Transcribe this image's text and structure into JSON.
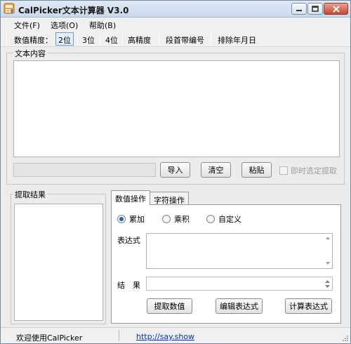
{
  "window": {
    "title": "CalPicker文本计算器 V3.0",
    "icon": "calculator-app-icon",
    "controls": [
      "minimize-icon",
      "maximize-icon",
      "close-icon"
    ]
  },
  "menu": {
    "file": "文件(F)",
    "options": "选项(O)",
    "help": "帮助(B)"
  },
  "toolbar": {
    "precision_label": "数值精度：",
    "p2": "2位",
    "p3": "3位",
    "p4": "4位",
    "high": "高精度",
    "para_num": "段首带编号",
    "exclude_date": "排除年月日",
    "selected": "2位"
  },
  "text_content": {
    "label": "文本内容",
    "value": "",
    "import": "导入",
    "clear": "清空",
    "paste": "粘贴",
    "instant_label": "即时选定提取",
    "instant_checked": false
  },
  "extract": {
    "label": "提取结果"
  },
  "tabs": {
    "numeric": "数值操作",
    "char": "字符操作",
    "active": "数值操作"
  },
  "numeric": {
    "mode_sum": "累加",
    "mode_product": "乘积",
    "mode_custom": "自定义",
    "selected_mode": "累加",
    "expr_label": "表达式",
    "expr_value": "",
    "result_label": "结　果",
    "result_value": "",
    "btn_extract": "提取数值",
    "btn_edit": "编辑表达式",
    "btn_calc": "计算表达式"
  },
  "status": {
    "message": "欢迎使用CalPicker",
    "link": "http://say.show"
  },
  "colors": {
    "accent": "#2563b8",
    "link": "#0033cc",
    "close": "#c44a33"
  }
}
